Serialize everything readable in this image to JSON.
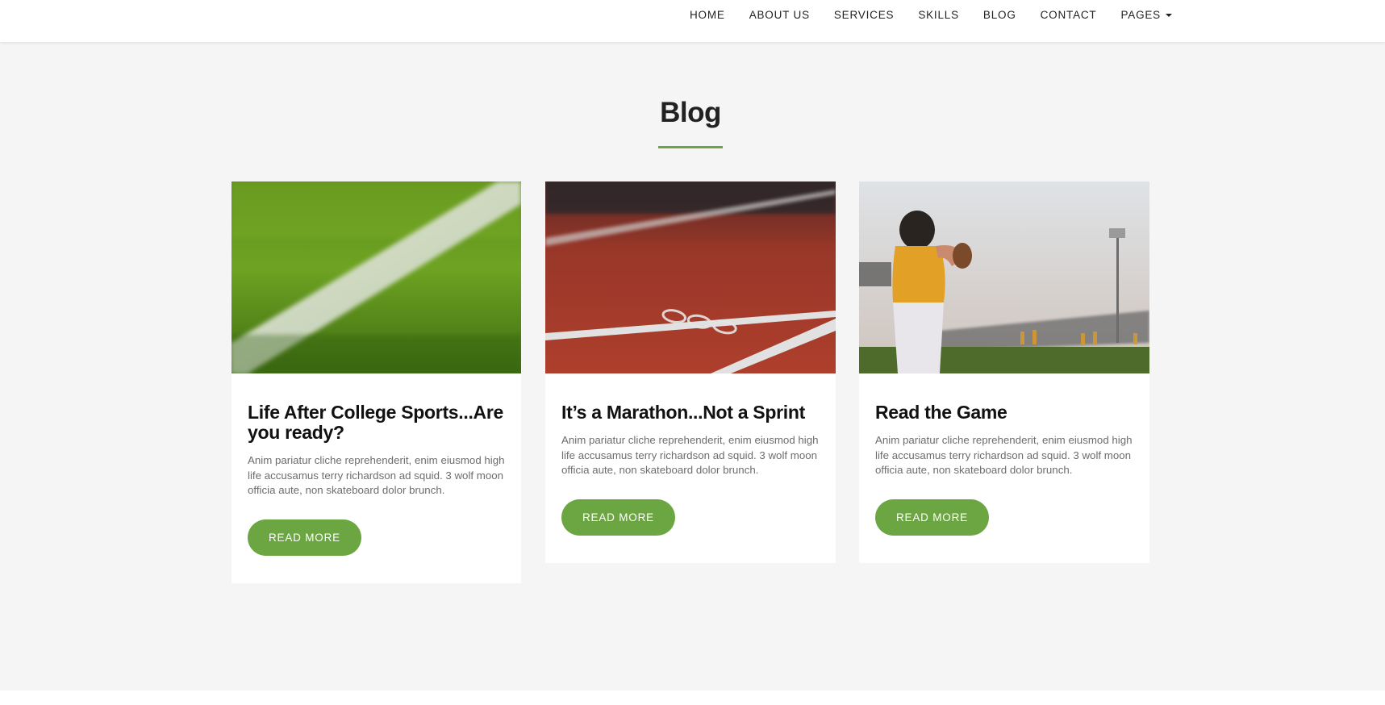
{
  "nav": {
    "items": [
      {
        "label": "HOME"
      },
      {
        "label": "ABOUT US"
      },
      {
        "label": "SERVICES"
      },
      {
        "label": "SKILLS"
      },
      {
        "label": "BLOG"
      },
      {
        "label": "CONTACT"
      },
      {
        "label": "PAGES",
        "has_dropdown": true
      }
    ]
  },
  "blog": {
    "title": "Blog",
    "accent_color": "#6ca642",
    "posts": [
      {
        "title": "Life After College Sports...Are you ready?",
        "excerpt": "Anim pariatur cliche reprehenderit, enim eiusmod high life accusamus terry richardson ad squid. 3 wolf moon officia aute, non skateboard dolor brunch.",
        "button": "READ MORE",
        "image": "grass-field-line-photo"
      },
      {
        "title": "It’s a Marathon...Not a Sprint",
        "excerpt": "Anim pariatur cliche reprehenderit, enim eiusmod high life accusamus terry richardson ad squid. 3 wolf moon officia aute, non skateboard dolor brunch.",
        "button": "READ MORE",
        "image": "running-track-800-photo"
      },
      {
        "title": "Read the Game",
        "excerpt": "Anim pariatur cliche reprehenderit, enim eiusmod high life accusamus terry richardson ad squid. 3 wolf moon officia aute, non skateboard dolor brunch.",
        "button": "READ MORE",
        "image": "football-quarterback-photo"
      }
    ]
  }
}
